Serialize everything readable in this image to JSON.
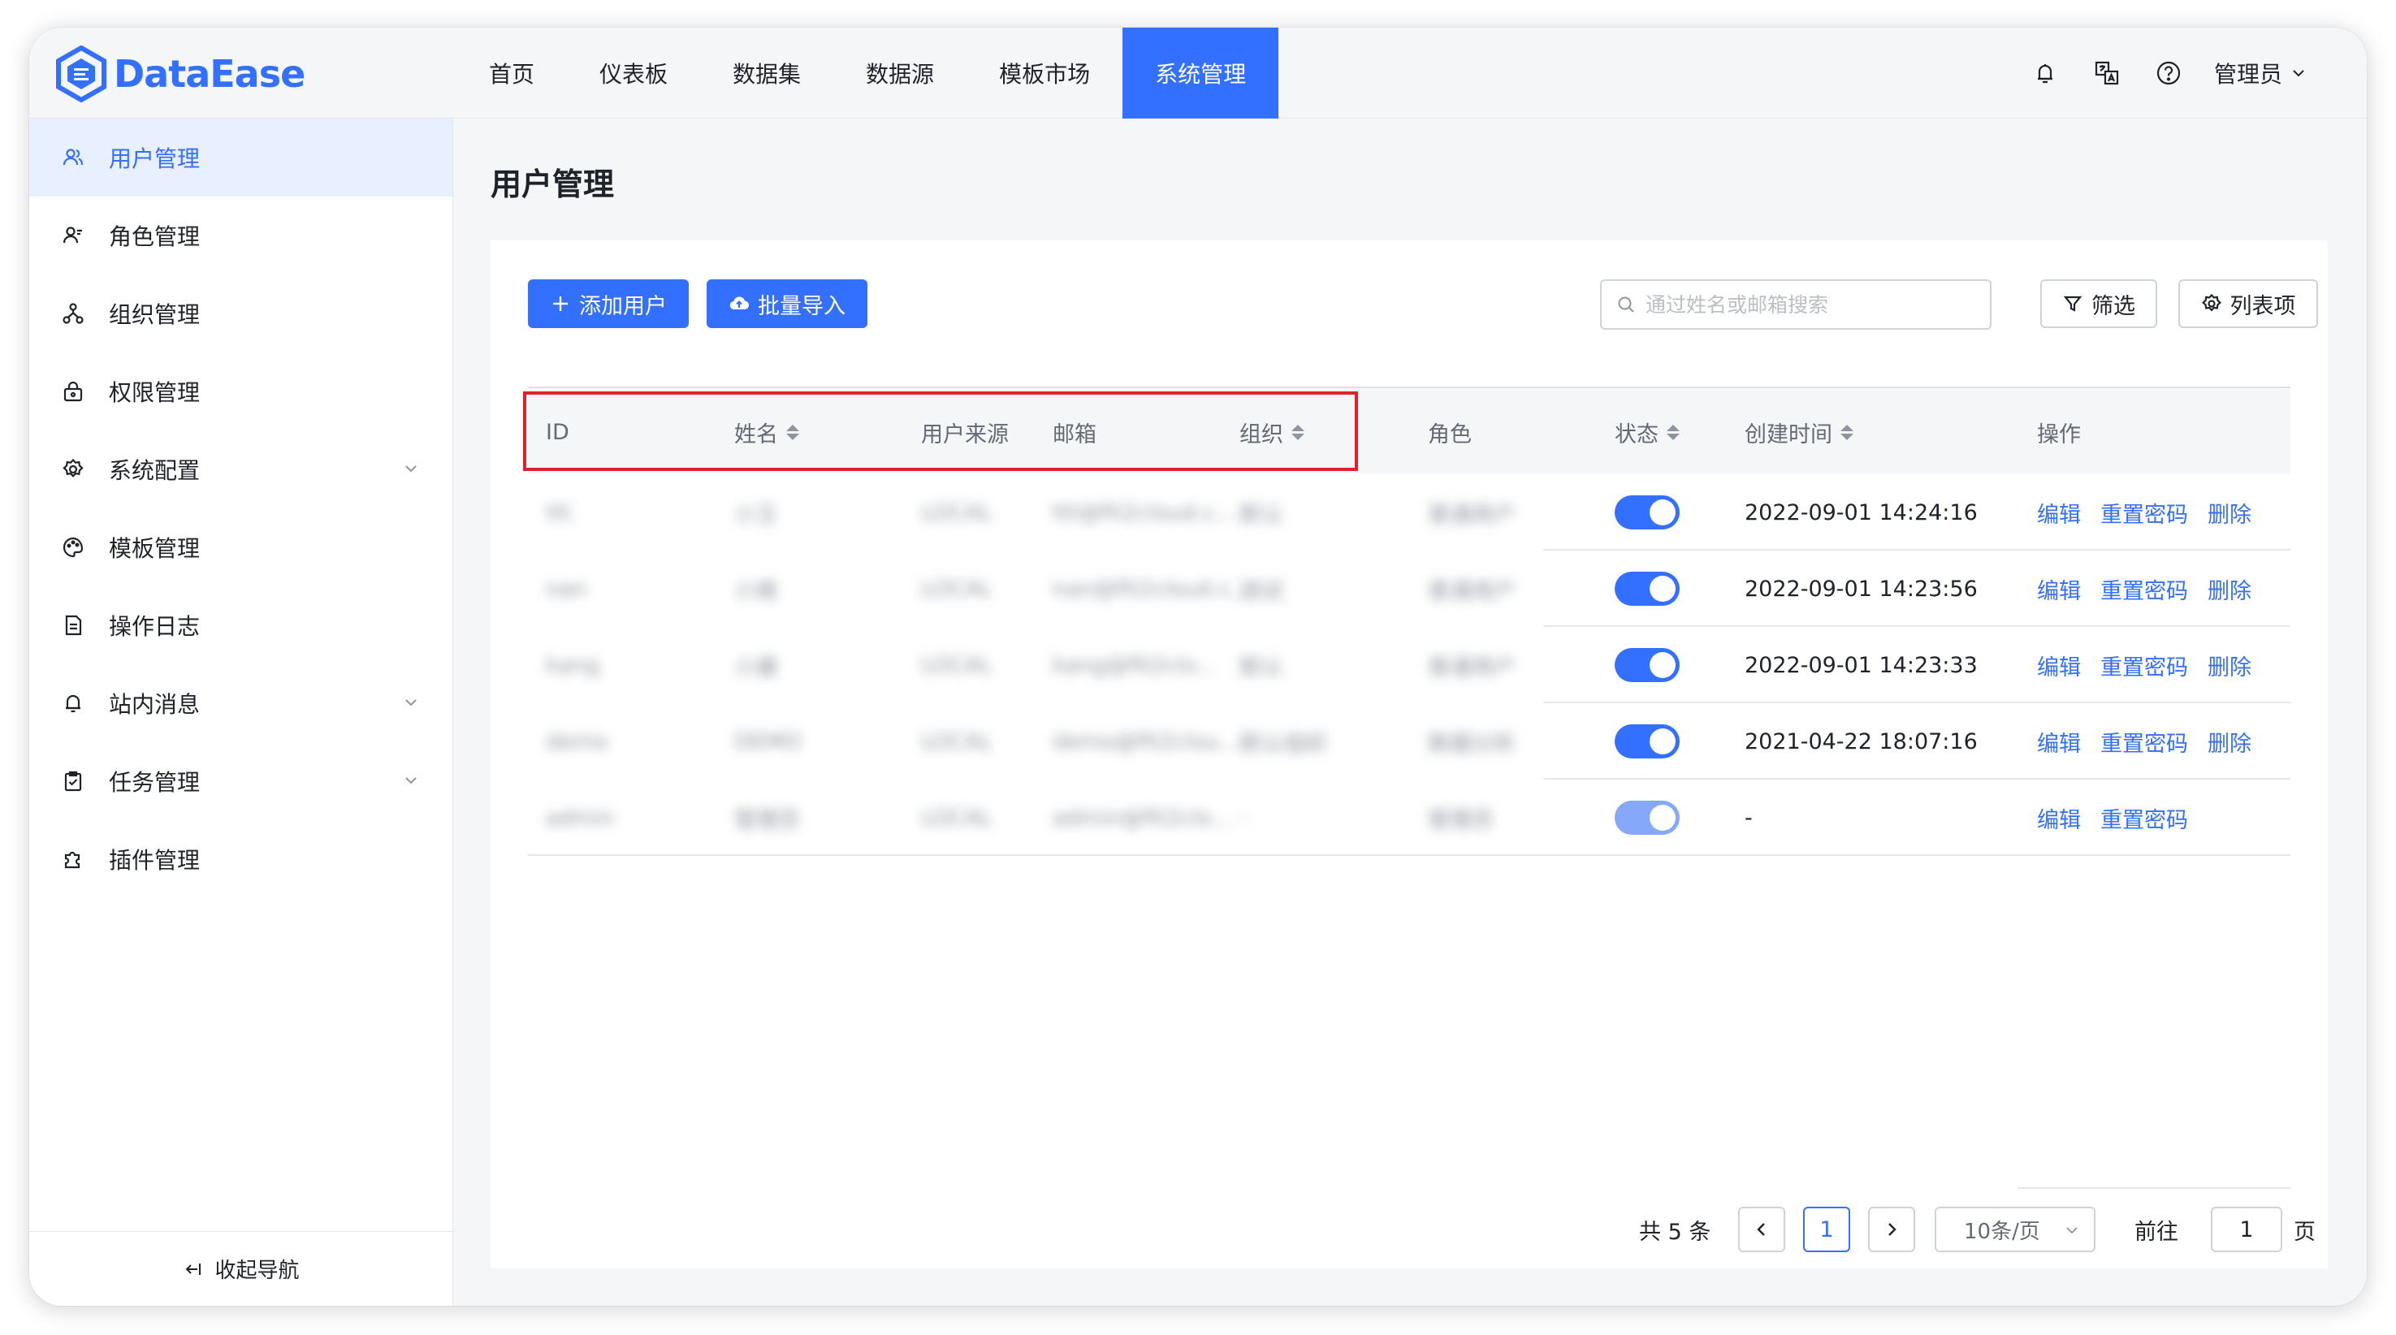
{
  "app": {
    "logo_text": "DataEase",
    "accent": "#3370ff"
  },
  "nav": {
    "items": [
      {
        "label": "首页"
      },
      {
        "label": "仪表板"
      },
      {
        "label": "数据集"
      },
      {
        "label": "数据源"
      },
      {
        "label": "模板市场"
      },
      {
        "label": "系统管理",
        "active": true
      }
    ]
  },
  "topbar": {
    "icons": [
      "notification-bell-icon",
      "translate-icon",
      "help-icon"
    ],
    "user_label": "管理员"
  },
  "sidebar": {
    "items": [
      {
        "label": "用户管理",
        "icon": "users-icon",
        "active": true
      },
      {
        "label": "角色管理",
        "icon": "role-icon"
      },
      {
        "label": "组织管理",
        "icon": "org-tree-icon"
      },
      {
        "label": "权限管理",
        "icon": "lock-icon"
      },
      {
        "label": "系统配置",
        "icon": "gear-icon",
        "expandable": true
      },
      {
        "label": "模板管理",
        "icon": "palette-icon"
      },
      {
        "label": "操作日志",
        "icon": "log-icon"
      },
      {
        "label": "站内消息",
        "icon": "bell-icon",
        "expandable": true
      },
      {
        "label": "任务管理",
        "icon": "task-icon",
        "expandable": true
      },
      {
        "label": "插件管理",
        "icon": "plugin-icon"
      }
    ],
    "collapse_label": "收起导航"
  },
  "page": {
    "title": "用户管理"
  },
  "toolbar": {
    "add_user_label": "添加用户",
    "batch_import_label": "批量导入",
    "search_placeholder": "通过姓名或邮箱搜索",
    "filter_label": "筛选",
    "columns_label": "列表项"
  },
  "table": {
    "headers": {
      "id": "ID",
      "name": "姓名",
      "source": "用户来源",
      "email": "邮箱",
      "org": "组织",
      "role": "角色",
      "status": "状态",
      "created": "创建时间",
      "ops": "操作"
    },
    "rows": [
      {
        "id": "ttt",
        "name": "小王",
        "source": "LOCAL",
        "email": "ttt@fit2cloud.c...",
        "org": "默认",
        "role": "普通用户",
        "status_on": true,
        "created": "2022-09-01 14:24:16",
        "ops": [
          "编辑",
          "重置密码",
          "删除"
        ]
      },
      {
        "id": "nan",
        "name": "小南",
        "source": "LOCAL",
        "email": "nan@fit2cloud.c...",
        "org": "测试",
        "role": "普通用户",
        "status_on": true,
        "created": "2022-09-01 14:23:56",
        "ops": [
          "编辑",
          "重置密码",
          "删除"
        ]
      },
      {
        "id": "kang",
        "name": "小康",
        "source": "LOCAL",
        "email": "kang@fit2clo...",
        "org": "默认",
        "role": "普通用户",
        "status_on": true,
        "created": "2022-09-01 14:23:33",
        "ops": [
          "编辑",
          "重置密码",
          "删除"
        ]
      },
      {
        "id": "demo",
        "name": "DEMO",
        "source": "LOCAL",
        "email": "demo@fit2clou...",
        "org": "默认组织",
        "role": "数据分析",
        "status_on": true,
        "created": "2021-04-22 18:07:16",
        "ops": [
          "编辑",
          "重置密码",
          "删除"
        ]
      },
      {
        "id": "admin",
        "name": "管理员",
        "source": "LOCAL",
        "email": "admin@fit2clo...",
        "org": "-",
        "role": "管理员",
        "status_on": true,
        "status_disabled": true,
        "created": "-",
        "ops": [
          "编辑",
          "重置密码"
        ]
      }
    ]
  },
  "pagination": {
    "total_label": "共 5 条",
    "current_page": "1",
    "page_size_label": "10条/页",
    "goto_label": "前往",
    "goto_value": "1",
    "page_suffix": "页"
  }
}
